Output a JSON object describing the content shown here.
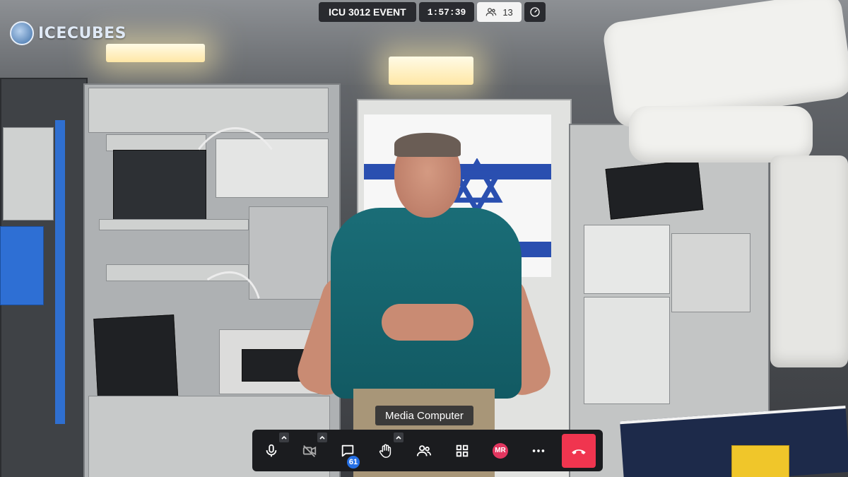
{
  "brand": {
    "logo_text": "ICECUBES"
  },
  "topbar": {
    "meeting_title": "ICU 3012 EVENT",
    "timer": "1:57:39",
    "participant_count": "13",
    "participants_icon": "participants-icon",
    "speed_icon": "performance-gauge-icon"
  },
  "speaker": {
    "name": "Media Computer"
  },
  "toolbar": {
    "microphone_icon": "microphone-icon",
    "camera_icon": "camera-off-icon",
    "chat_icon": "chat-icon",
    "chat_unread": "61",
    "raise_hand_icon": "raise-hand-icon",
    "participants_icon": "participants-icon",
    "tile_view_icon": "tile-view-icon",
    "avatar_initials": "MR",
    "avatar_color": "#e2365f",
    "more_icon": "more-icon",
    "hangup_icon": "hangup-icon",
    "hangup_color": "#f0354f"
  }
}
